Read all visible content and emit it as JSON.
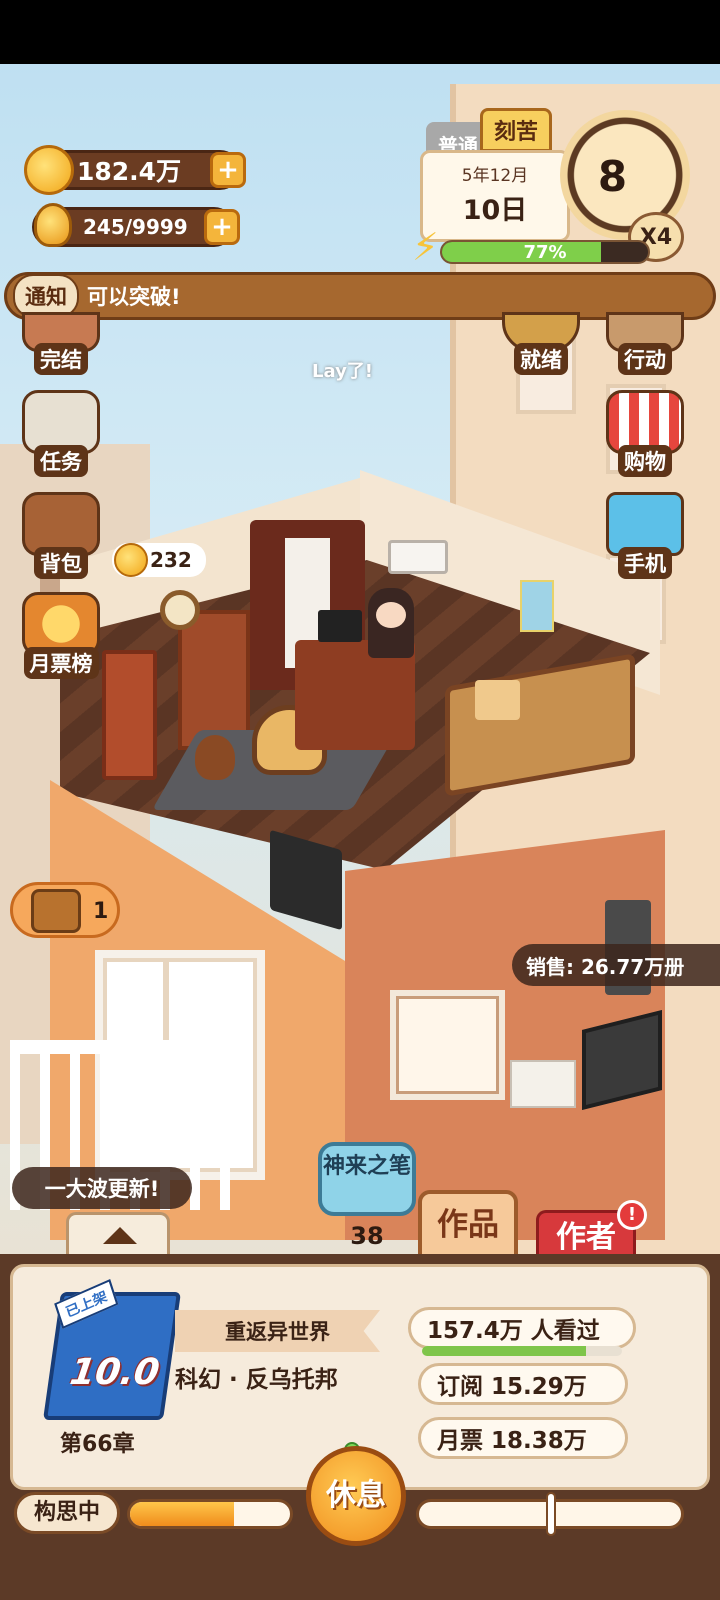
{
  "resources": {
    "coins": "182.4万",
    "ideas": "245/9999"
  },
  "mode_tabs": {
    "normal": "普通",
    "hard": "刻苦"
  },
  "calendar": {
    "year_month": "5年12月",
    "day": "10日"
  },
  "clock": {
    "hour": "8",
    "speed": "X4"
  },
  "energy": {
    "percent_label": "77%",
    "fraction": 0.77
  },
  "notice": {
    "tag": "通知",
    "message": "可以突破!"
  },
  "left_menu": [
    {
      "label": "完结",
      "icon": "book-stack-icon"
    },
    {
      "label": "任务",
      "icon": "checklist-icon"
    },
    {
      "label": "背包",
      "icon": "backpack-icon"
    },
    {
      "label": "月票榜",
      "icon": "medal-icon"
    }
  ],
  "right_menu": [
    {
      "label": "就绪",
      "icon": "gong-icon"
    },
    {
      "label": "行动",
      "icon": "door-icon"
    },
    {
      "label": "购物",
      "icon": "shop-icon"
    },
    {
      "label": "手机",
      "icon": "phone-icon"
    }
  ],
  "scene": {
    "floating_text": "Lay了!",
    "coin_bubble": "232",
    "chest_count": "1",
    "sales": "销售: 26.77万册",
    "update_banner": "一大波更新!"
  },
  "skill": {
    "label": "神来之笔",
    "count": "38"
  },
  "tabs": {
    "works": "作品",
    "author": "作者",
    "author_alert": "!"
  },
  "book": {
    "status": "已上架",
    "score": "10.0",
    "chapter": "第66章",
    "title": "重返异世界",
    "genre": "科幻 · 反乌托邦",
    "readers": "157.4万 人看过",
    "readers_fraction": 0.82,
    "subscriptions": "订阅 15.29万",
    "monthly_tickets": "月票 18.38万"
  },
  "footer": {
    "state": "构思中",
    "progress_fraction": 0.65,
    "rest_button": "休息"
  },
  "colors": {
    "accent": "#f4b53b",
    "panel": "#5c3a27",
    "author_tab": "#d7393c",
    "skill": "#8fd3e8"
  }
}
